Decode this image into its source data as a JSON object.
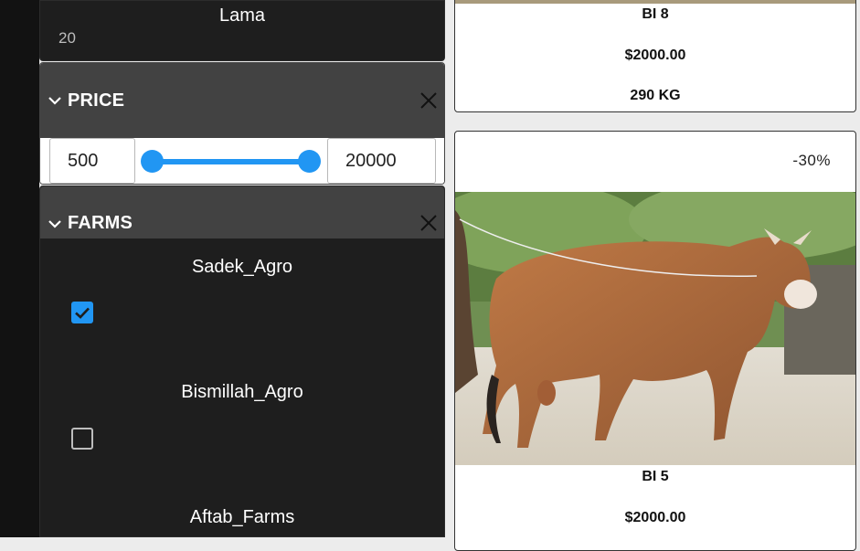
{
  "filters": {
    "lama": {
      "label": "Lama",
      "count": "20"
    },
    "price": {
      "title": "PRICE",
      "min_value": "500",
      "max_value": "20000",
      "slider": {
        "min": 500,
        "max": 20000,
        "low": 500,
        "high": 20000
      }
    },
    "farms": {
      "title": "FARMS",
      "items": [
        {
          "label": "Sadek_Agro",
          "checked": true
        },
        {
          "label": "Bismillah_Agro",
          "checked": false
        },
        {
          "label": "Aftab_Farms",
          "checked": false
        }
      ]
    }
  },
  "products": [
    {
      "name": "BI 8",
      "price": "$2000.00",
      "weight": "290 KG"
    },
    {
      "discount": "-30%",
      "name": "BI 5",
      "price": "$2000.00"
    }
  ],
  "colors": {
    "accent": "#2196f3",
    "panel": "#1e1e1e",
    "header": "#424242"
  },
  "icons": {
    "collapse": "chevron-down-icon",
    "clear": "close-icon",
    "checked": "checkbox-checked-icon",
    "unchecked": "checkbox-empty-icon"
  }
}
